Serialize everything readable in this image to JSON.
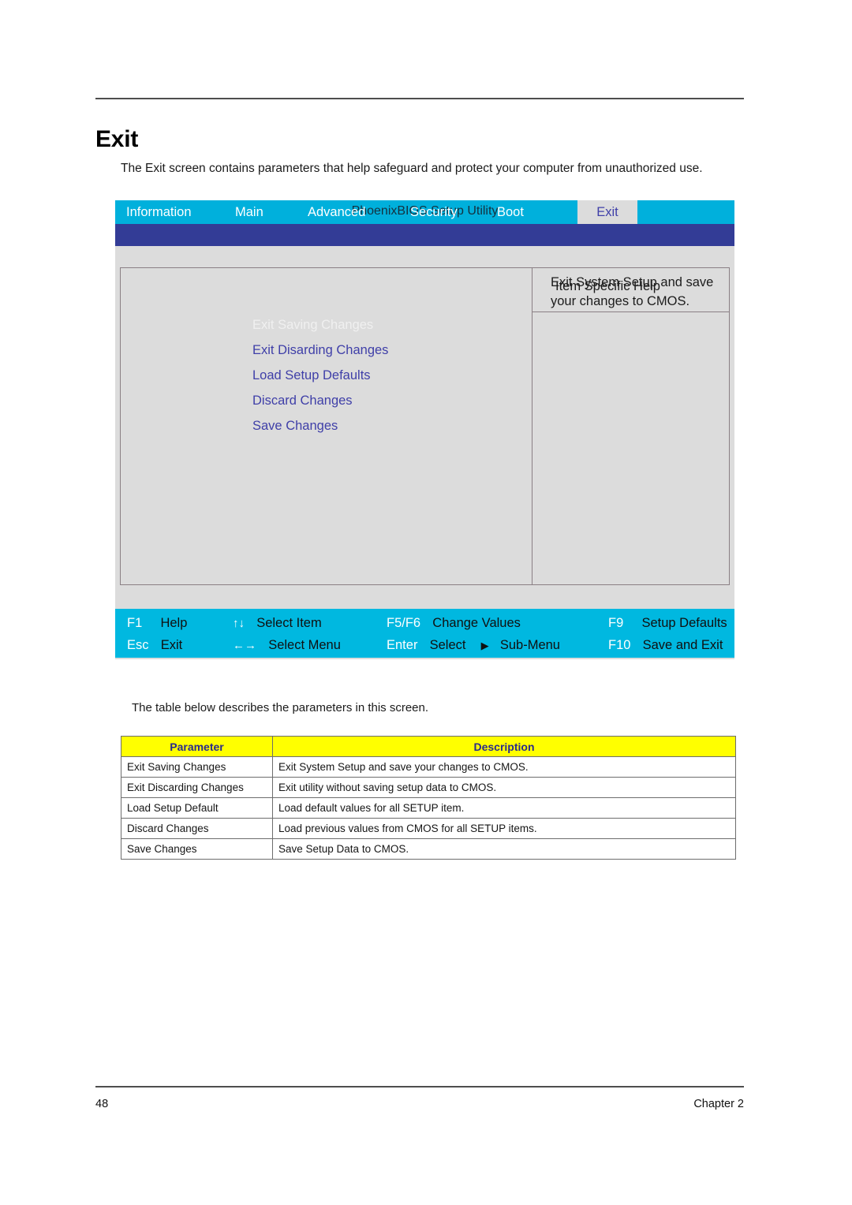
{
  "page": {
    "title": "Exit",
    "intro": "The Exit screen contains parameters that help safeguard and protect your computer from unauthorized use.",
    "mid_text": "The table below describes the parameters in this screen.",
    "footer": {
      "page_number": "48",
      "chapter": "Chapter 2"
    }
  },
  "bios": {
    "title": "PhoenixBIOS Setup Utility",
    "tabs": [
      {
        "label": "Information",
        "selected": false
      },
      {
        "label": "Main",
        "selected": false
      },
      {
        "label": "Advanced",
        "selected": false
      },
      {
        "label": "Security",
        "selected": false
      },
      {
        "label": "Boot",
        "selected": false
      },
      {
        "label": "Exit",
        "selected": true
      }
    ],
    "menu_items": [
      {
        "label": "Exit Saving Changes",
        "highlighted": true
      },
      {
        "label": "Exit Disarding Changes",
        "highlighted": false
      },
      {
        "label": "Load Setup Defaults",
        "highlighted": false
      },
      {
        "label": "Discard Changes",
        "highlighted": false
      },
      {
        "label": "Save Changes",
        "highlighted": false
      }
    ],
    "help": {
      "header": "Item Specific Help",
      "body": "Exit System Setup and save your changes to CMOS."
    },
    "function_keys": [
      {
        "key": "F1",
        "action": "Help"
      },
      {
        "key": "↑↓",
        "action": "Select Item"
      },
      {
        "key": "F5/F6",
        "action": "Change Values"
      },
      {
        "key": "F9",
        "action": "Setup Defaults"
      },
      {
        "key": "Esc",
        "action": "Exit"
      },
      {
        "key": "←→",
        "action": "Select Menu"
      },
      {
        "key": "Enter",
        "action": "Select"
      },
      {
        "key": "F10",
        "action": "Save and Exit"
      }
    ],
    "submenu_label": "Sub-Menu",
    "submenu_glyph": "▶",
    "colors": {
      "title_bar": "#00b0dc",
      "tab_bar": "#333c96",
      "function_bar": "#00b8e0",
      "panel": "#dcdcdc",
      "menu_text": "#3f3fa8",
      "table_header": "#ffff00"
    }
  },
  "table": {
    "headers": [
      "Parameter",
      "Description"
    ],
    "rows": [
      [
        "Exit Saving Changes",
        "Exit System Setup and save your changes to CMOS."
      ],
      [
        "Exit Discarding Changes",
        "Exit utility without saving setup data to CMOS."
      ],
      [
        "Load Setup Default",
        "Load default values for all SETUP item."
      ],
      [
        "Discard Changes",
        "Load previous values from CMOS for all SETUP items."
      ],
      [
        "Save Changes",
        "Save Setup Data to CMOS."
      ]
    ]
  }
}
